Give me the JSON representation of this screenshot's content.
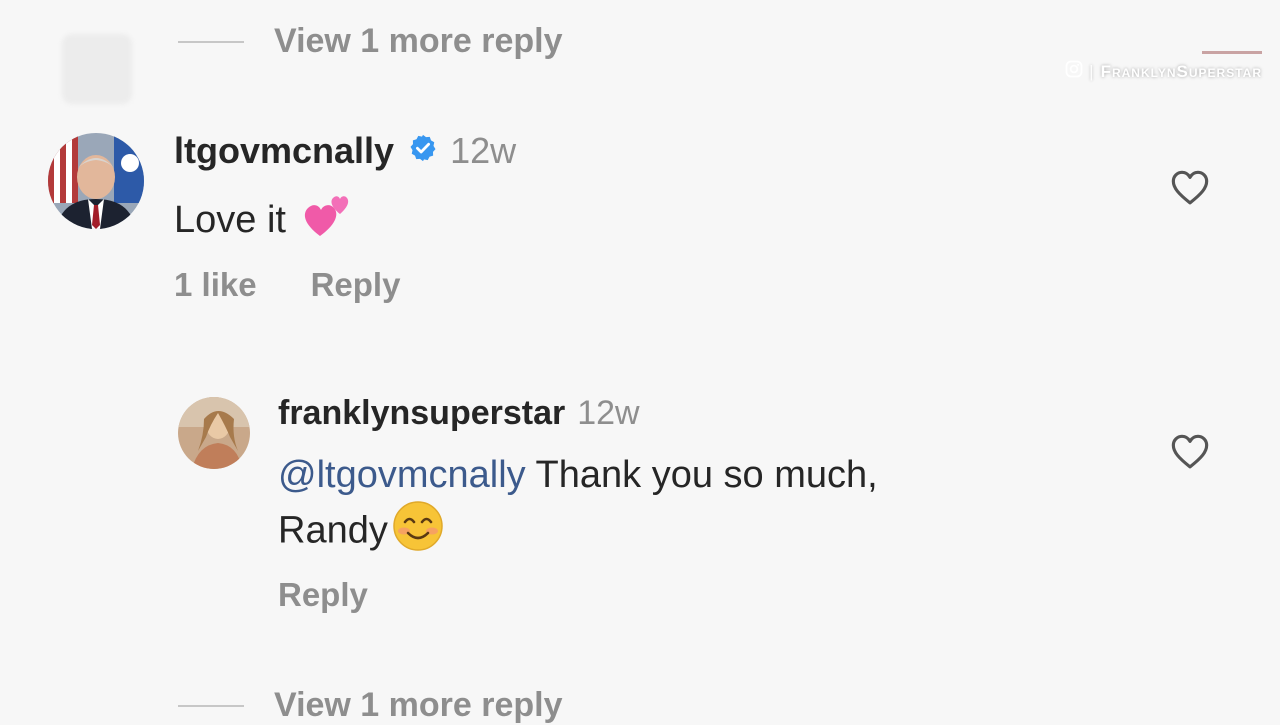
{
  "thread": {
    "view_more_top": "View 1 more reply",
    "view_more_bottom": "View 1 more reply"
  },
  "watermark": {
    "icon": "instagram-icon",
    "separator": "|",
    "handle": "FranklynSuperstar"
  },
  "comment": {
    "username": "ltgovmcnally",
    "verified": true,
    "time": "12w",
    "text": "Love it",
    "emoji": "two-hearts-emoji",
    "likes": "1 like",
    "reply_label": "Reply",
    "liked": false
  },
  "reply": {
    "username": "franklynsuperstar",
    "time": "12w",
    "mention": "@ltgovmcnally",
    "text_line1": " Thank you so much,",
    "text_line2": "Randy",
    "emoji": "smiling-face-emoji",
    "reply_label": "Reply",
    "liked": false
  },
  "colors": {
    "background": "#f7f7f7",
    "primary_text": "#262626",
    "secondary_text": "#8e8e8e",
    "mention": "#3c5a8c",
    "verified_badge": "#3897f0"
  }
}
